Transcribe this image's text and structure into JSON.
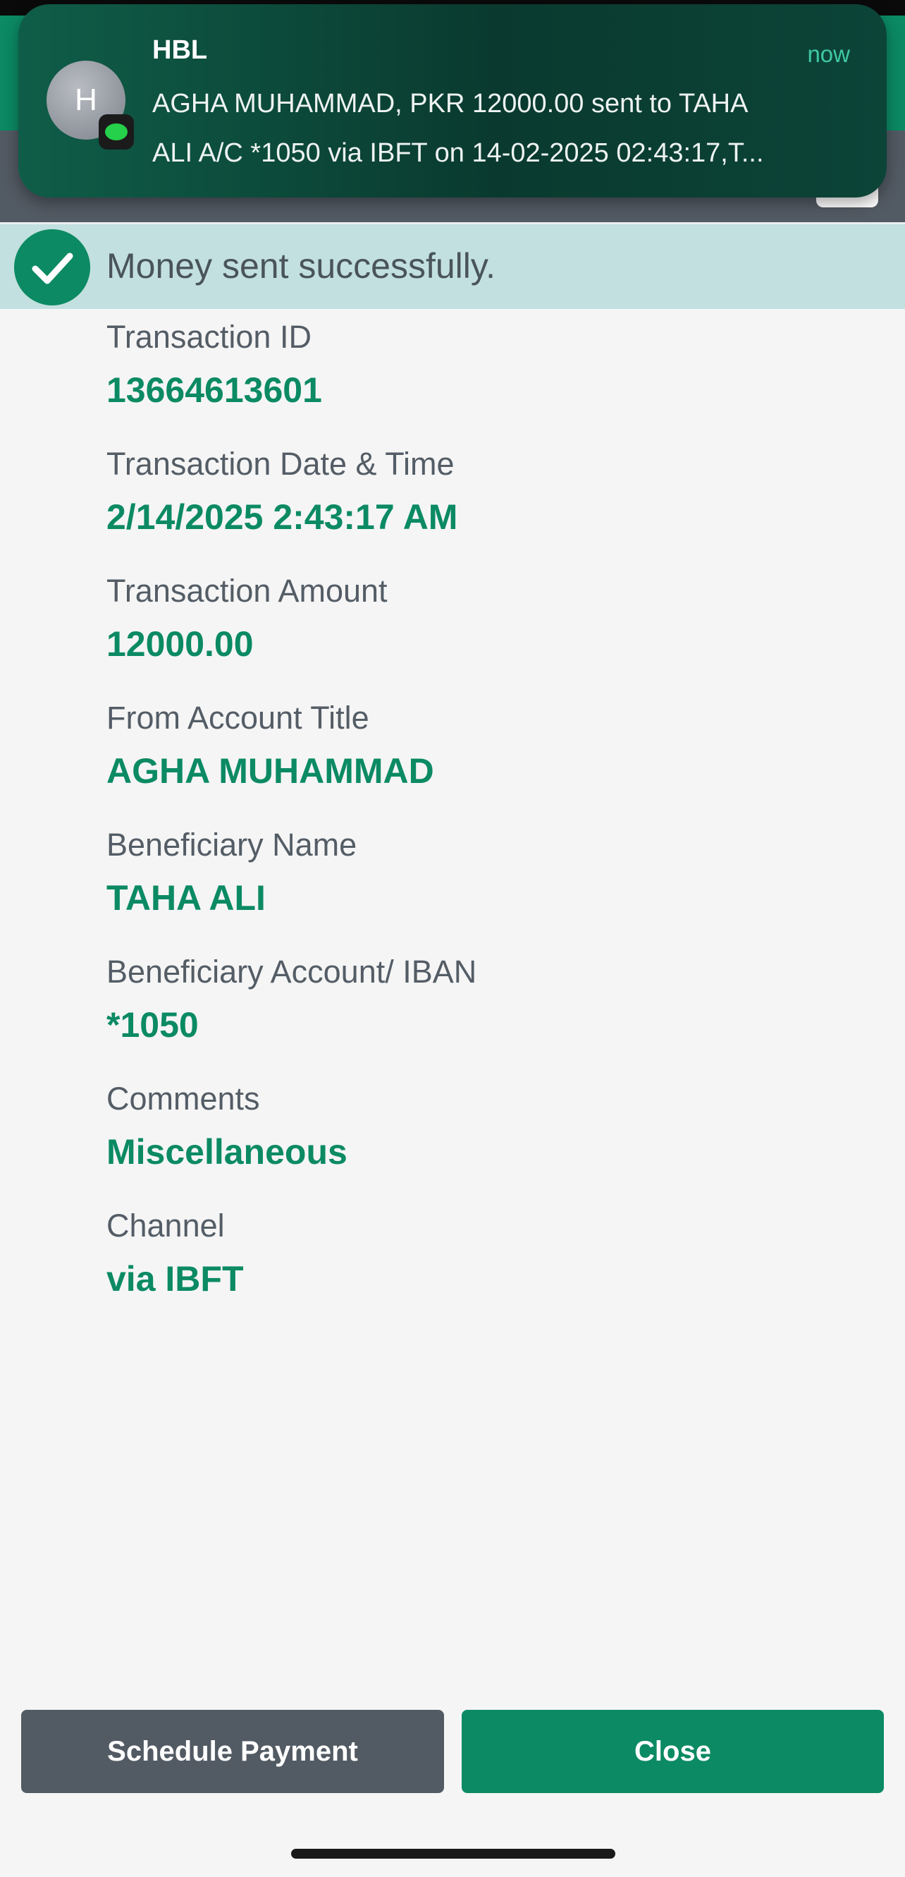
{
  "notification": {
    "avatar_letter": "H",
    "app_name": "HBL",
    "time": "now",
    "line1": "AGHA MUHAMMAD, PKR 12000.00 sent to TAHA",
    "line2": "ALI A/C *1050 via IBFT on 14-02-2025 02:43:17,T..."
  },
  "banner": {
    "message": "Money sent successfully."
  },
  "details": {
    "items": [
      {
        "label": "Transaction ID",
        "value": "13664613601"
      },
      {
        "label": "Transaction Date & Time",
        "value": "2/14/2025 2:43:17 AM"
      },
      {
        "label": "Transaction Amount",
        "value": "12000.00"
      },
      {
        "label": "From Account Title",
        "value": "AGHA MUHAMMAD"
      },
      {
        "label": "Beneficiary Name",
        "value": "TAHA ALI"
      },
      {
        "label": "Beneficiary Account/ IBAN",
        "value": "*1050"
      },
      {
        "label": "Comments",
        "value": "Miscellaneous"
      },
      {
        "label": "Channel",
        "value": "via IBFT"
      }
    ]
  },
  "actions": {
    "schedule_label": "Schedule Payment",
    "close_label": "Close"
  },
  "colors": {
    "brand_green": "#0b8a63",
    "banner_bg": "#c2e0df",
    "gray_button": "#525a63"
  },
  "icons": {
    "success": "check-circle-icon",
    "notification_app": "message-bubble-icon"
  }
}
